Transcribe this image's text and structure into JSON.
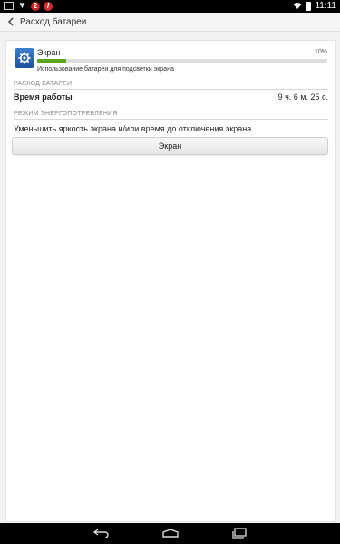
{
  "statusbar": {
    "icons": [
      "image-icon",
      "shield-icon",
      "notification-2-icon",
      "notification-l-icon"
    ],
    "badge1": "2",
    "badge2": "l",
    "time": "11:11"
  },
  "actionbar": {
    "title": "Расход батареи"
  },
  "app": {
    "name": "Экран",
    "percent_text": "10%",
    "percent_value": 10,
    "description": "Использование батареи для подсветки экрана",
    "bar_color": "#5aa61a"
  },
  "battery_section": {
    "header": "РАСХОД БАТАРЕИ",
    "time_label": "Время работы",
    "time_value": "9 ч. 6 м. 25 с."
  },
  "power_section": {
    "header": "РЕЖИМ ЭНЕРГОПОТРЕБЛЕНИЯ",
    "text": "Уменьшить яркость экрана и/или время до отключения экрана",
    "button_label": "Экран"
  },
  "navbar": {
    "icons": [
      "back-icon",
      "home-icon",
      "recents-icon"
    ]
  }
}
